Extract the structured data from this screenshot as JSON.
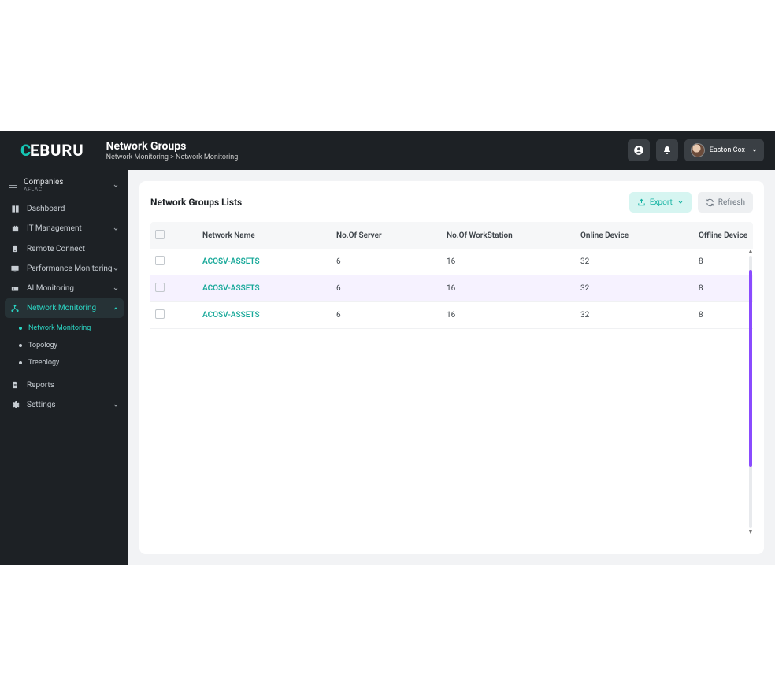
{
  "logo": {
    "first": "C",
    "rest": "EBURU"
  },
  "header": {
    "title": "Network Groups",
    "breadcrumb": "Network Monitoring > Network Monitoring",
    "user": "Easton Cox"
  },
  "sidebar": {
    "companies_label": "Companies",
    "companies_sub": "AFLAC",
    "items": [
      {
        "label": "Dashboard",
        "expandable": false
      },
      {
        "label": "IT Management",
        "expandable": true
      },
      {
        "label": "Remote Connect",
        "expandable": false
      },
      {
        "label": "Performance Monitoring",
        "expandable": true
      },
      {
        "label": "AI Monitoring",
        "expandable": true
      },
      {
        "label": "Network Monitoring",
        "expandable": true
      },
      {
        "label": "Reports",
        "expandable": false
      },
      {
        "label": "Settings",
        "expandable": true
      }
    ],
    "network_sub": [
      {
        "label": "Network Monitoring"
      },
      {
        "label": "Topology"
      },
      {
        "label": "Treeology"
      }
    ]
  },
  "card": {
    "title": "Network Groups Lists",
    "export_label": "Export",
    "refresh_label": "Refresh"
  },
  "table": {
    "cols": {
      "c1": "Network Name",
      "c2": "No.Of Server",
      "c3": "No.Of WorkStation",
      "c4": "Online Device",
      "c5": "Offline Device"
    },
    "rows": [
      {
        "name": "ACOSV-ASSETS",
        "server": "6",
        "ws": "16",
        "online": "32",
        "offline": "8"
      },
      {
        "name": "ACOSV-ASSETS",
        "server": "6",
        "ws": "16",
        "online": "32",
        "offline": "8"
      },
      {
        "name": "ACOSV-ASSETS",
        "server": "6",
        "ws": "16",
        "online": "32",
        "offline": "8"
      }
    ]
  }
}
